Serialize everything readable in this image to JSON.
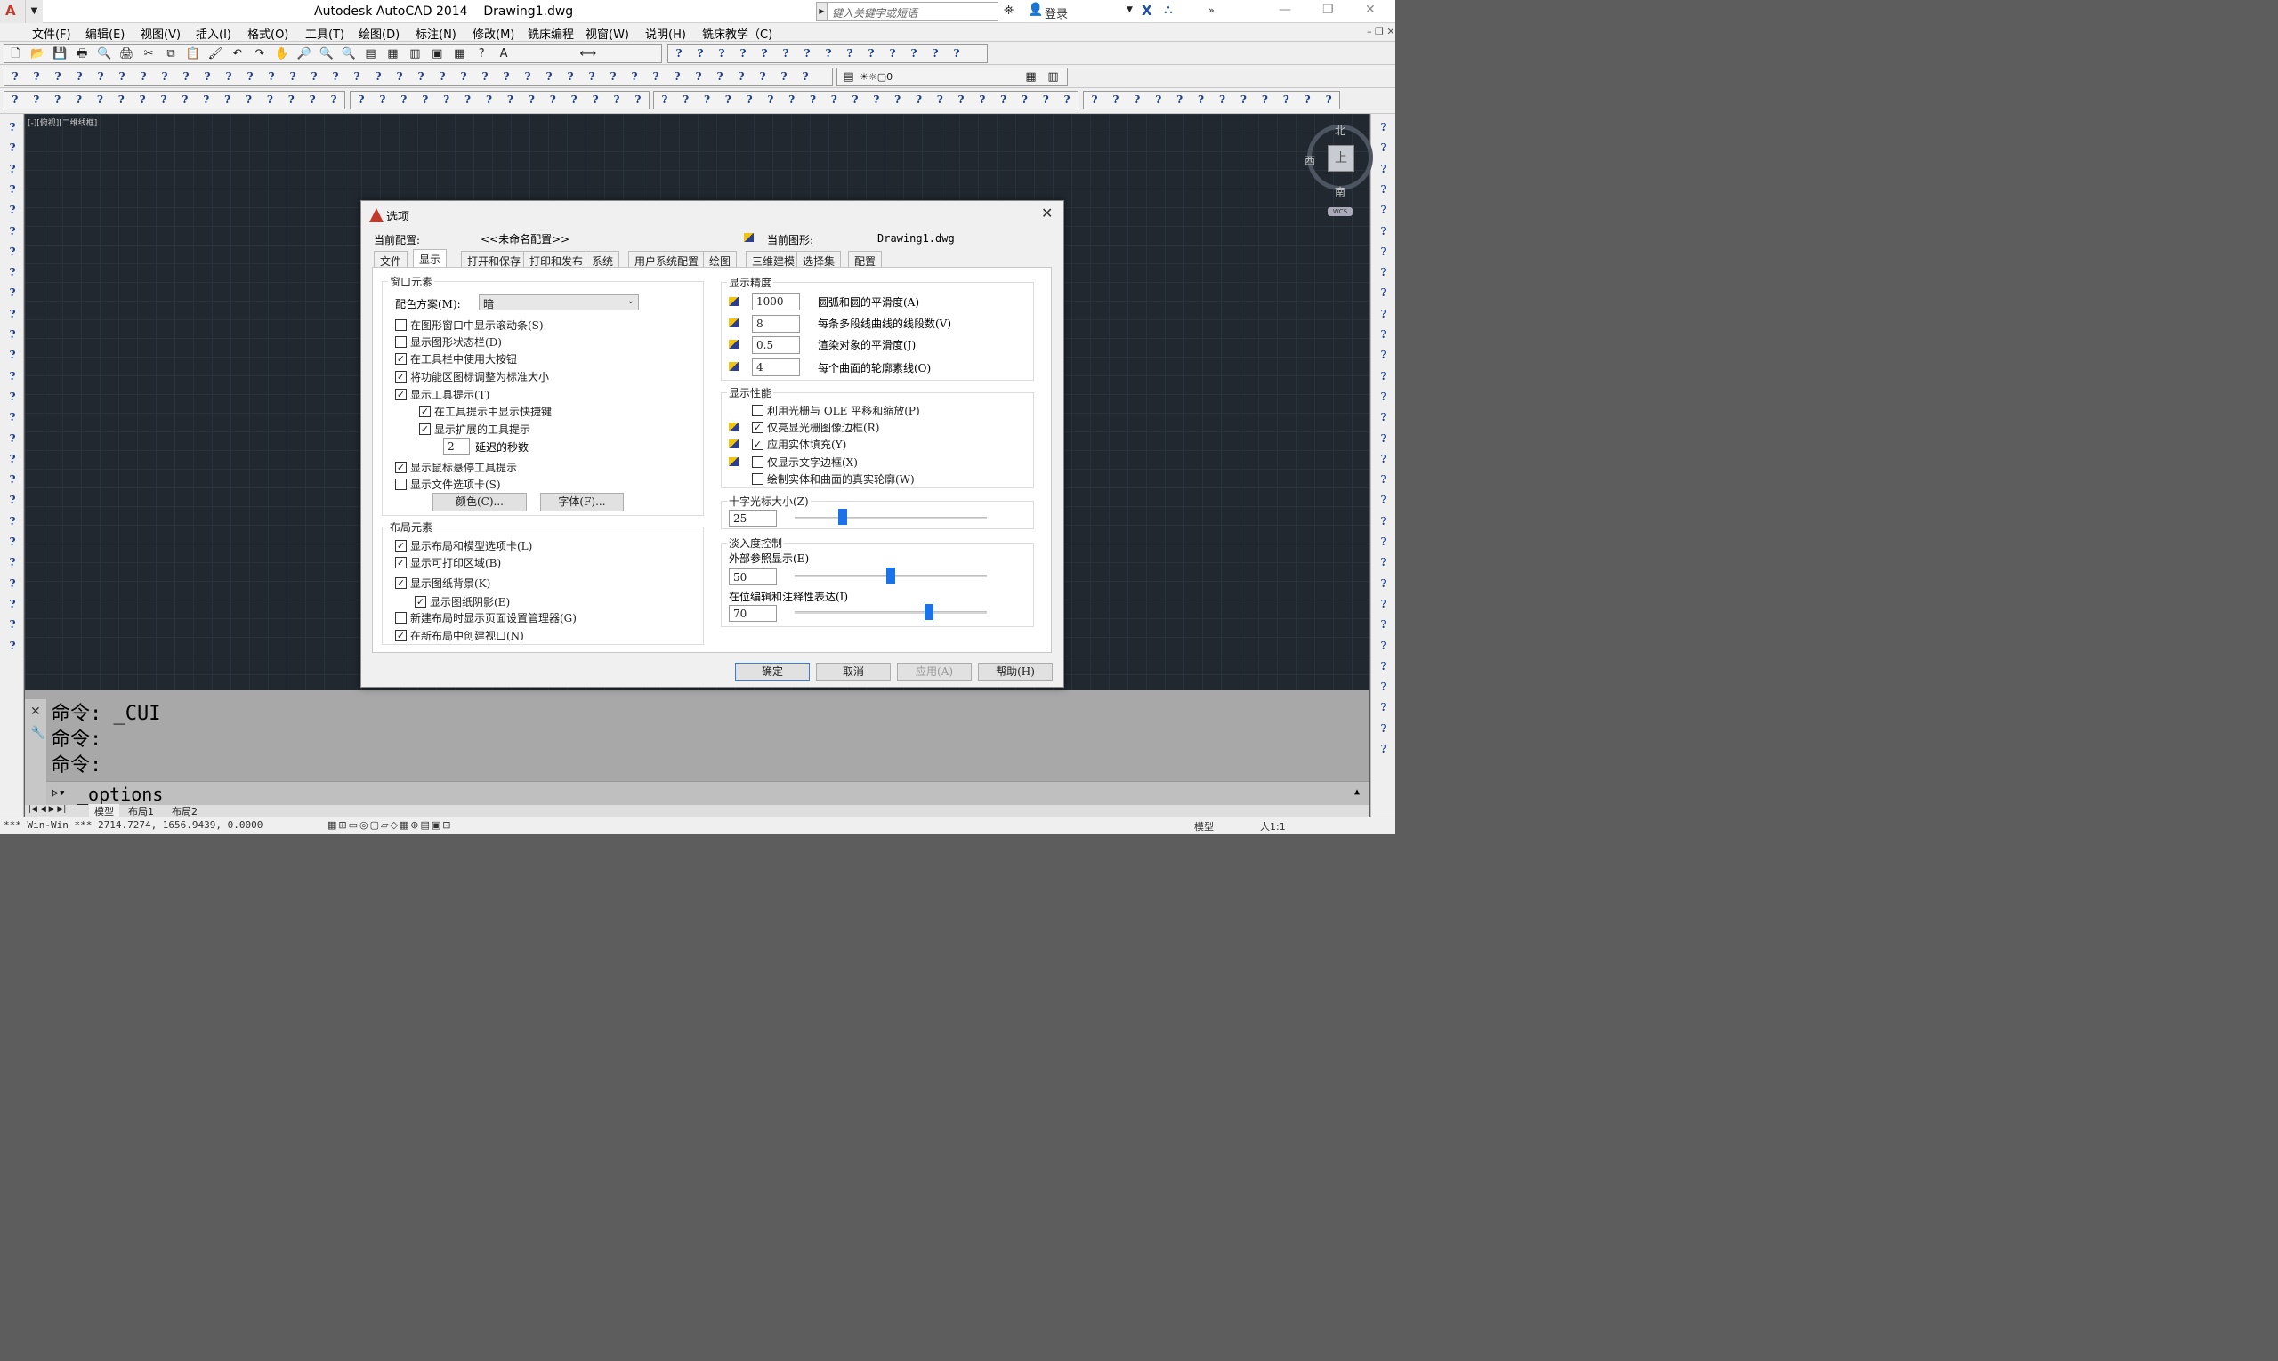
{
  "window": {
    "title": "Autodesk AutoCAD 2014    Drawing1.dwg",
    "search_placeholder": "键入关键字或短语",
    "login": "登录"
  },
  "menu": [
    "文件(F)",
    "编辑(E)",
    "视图(V)",
    "插入(I)",
    "格式(O)",
    "工具(T)",
    "绘图(D)",
    "标注(N)",
    "修改(M)",
    "铣床编程",
    "视窗(W)",
    "说明(H)",
    "铣床教学（C)"
  ],
  "toolbar": {
    "placeholder_glyph": "?",
    "layer_value": "0"
  },
  "viewport": {
    "label": "[-][俯视][二维线框]"
  },
  "viewcube": {
    "north": "北",
    "south": "南",
    "west": "西",
    "top": "上",
    "wcs": "WCS"
  },
  "command": {
    "history": [
      "命令: _CUI",
      "命令:",
      "命令:"
    ],
    "input": "_options"
  },
  "status": {
    "coords": "*** Win-Win ***  2714.7274, 1656.9439, 0.0000",
    "model": "模型",
    "scale": "人1:1"
  },
  "layout_tabs": [
    "模型",
    "布局1",
    "布局2"
  ],
  "dialog": {
    "title": "选项",
    "current_profile_label": "当前配置:",
    "current_profile_value": "<<未命名配置>>",
    "current_drawing_label": "当前图形:",
    "current_drawing_value": "Drawing1.dwg",
    "tabs": [
      "文件",
      "显示",
      "打开和保存",
      "打印和发布",
      "系统",
      "用户系统配置",
      "绘图",
      "三维建模",
      "选择集",
      "配置"
    ],
    "active_tab": "显示",
    "window_elements": {
      "title": "窗口元素",
      "color_scheme_label": "配色方案(M):",
      "color_scheme_value": "暗",
      "options": [
        {
          "label": "在图形窗口中显示滚动条(S)",
          "checked": false
        },
        {
          "label": "显示图形状态栏(D)",
          "checked": false
        },
        {
          "label": "在工具栏中使用大按钮",
          "checked": true
        },
        {
          "label": "将功能区图标调整为标准大小",
          "checked": true
        },
        {
          "label": "显示工具提示(T)",
          "checked": true
        },
        {
          "label": "在工具提示中显示快捷键",
          "checked": true
        },
        {
          "label": "显示扩展的工具提示",
          "checked": true
        },
        {
          "label": "显示鼠标悬停工具提示",
          "checked": true
        },
        {
          "label": "显示文件选项卡(S)",
          "checked": false
        }
      ],
      "delay_value": "2",
      "delay_label": "延迟的秒数",
      "colors_button": "颜色(C)...",
      "fonts_button": "字体(F)..."
    },
    "layout_elements": {
      "title": "布局元素",
      "options": [
        {
          "label": "显示布局和模型选项卡(L)",
          "checked": true
        },
        {
          "label": "显示可打印区域(B)",
          "checked": true
        },
        {
          "label": "显示图纸背景(K)",
          "checked": true
        },
        {
          "label": "显示图纸阴影(E)",
          "checked": true
        },
        {
          "label": "新建布局时显示页面设置管理器(G)",
          "checked": false
        },
        {
          "label": "在新布局中创建视口(N)",
          "checked": true
        }
      ]
    },
    "resolution": {
      "title": "显示精度",
      "items": [
        {
          "value": "1000",
          "label": "圆弧和圆的平滑度(A)"
        },
        {
          "value": "8",
          "label": "每条多段线曲线的线段数(V)"
        },
        {
          "value": "0.5",
          "label": "渲染对象的平滑度(J)"
        },
        {
          "value": "4",
          "label": "每个曲面的轮廓素线(O)"
        }
      ]
    },
    "performance": {
      "title": "显示性能",
      "options": [
        {
          "label": "利用光栅与 OLE 平移和缩放(P)",
          "checked": false
        },
        {
          "label": "仅亮显光栅图像边框(R)",
          "checked": true
        },
        {
          "label": "应用实体填充(Y)",
          "checked": true
        },
        {
          "label": "仅显示文字边框(X)",
          "checked": false
        },
        {
          "label": "绘制实体和曲面的真实轮廓(W)",
          "checked": false
        }
      ]
    },
    "crosshair": {
      "title": "十字光标大小(Z)",
      "value": "25",
      "fraction": 0.25
    },
    "fade": {
      "title": "淡入度控制",
      "xref_label": "外部参照显示(E)",
      "xref_value": "50",
      "xref_fraction": 0.5,
      "inplace_label": "在位编辑和注释性表达(I)",
      "inplace_value": "70",
      "inplace_fraction": 0.7
    },
    "buttons": {
      "ok": "确定",
      "cancel": "取消",
      "apply": "应用(A)",
      "help": "帮助(H)"
    }
  }
}
